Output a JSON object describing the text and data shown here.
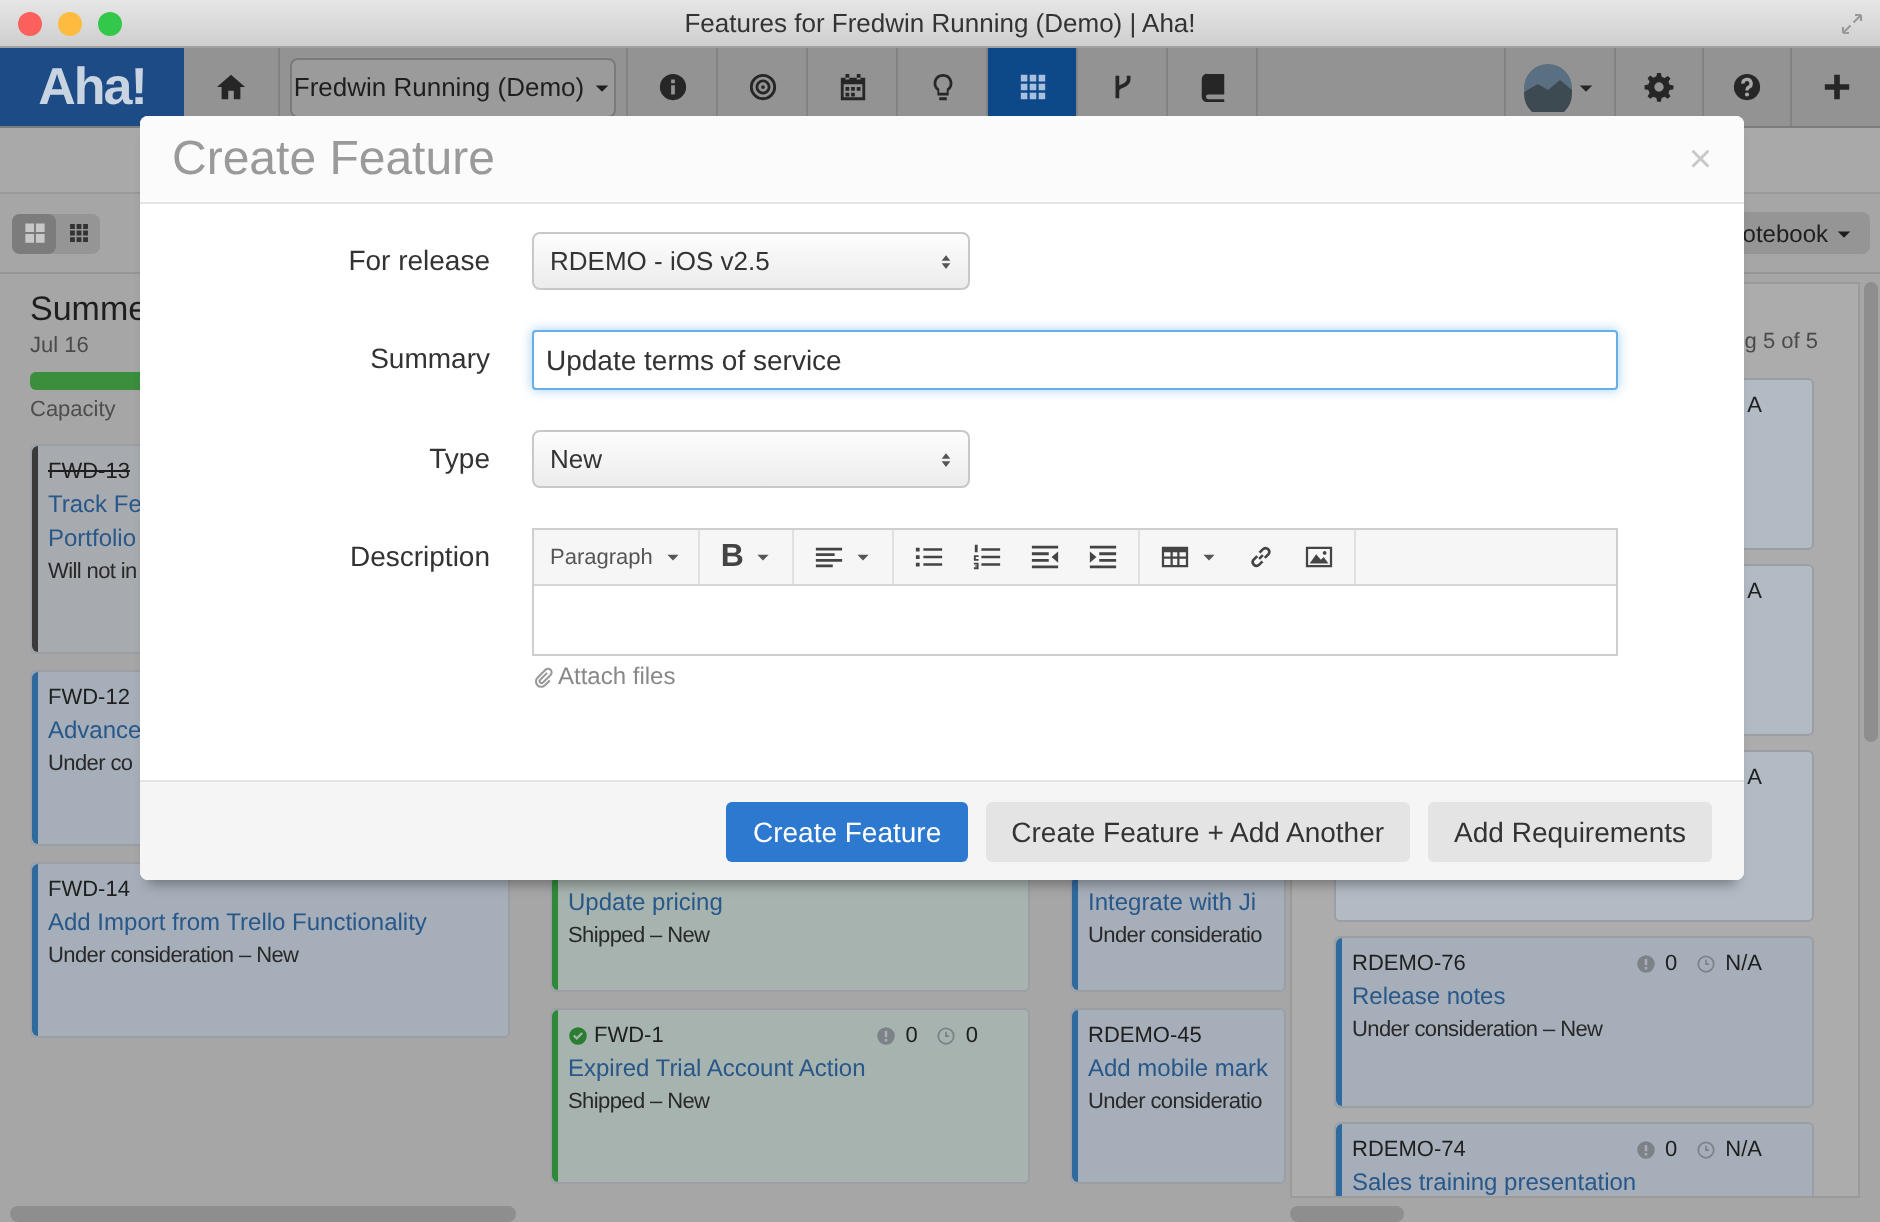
{
  "window": {
    "title": "Features for Fredwin Running (Demo) | Aha!"
  },
  "nav": {
    "logo": "Aha!",
    "home": {
      "kind": "home",
      "selected": false
    },
    "product": "Fredwin Running (Demo)",
    "items": [
      {
        "kind": "info",
        "selected": false
      },
      {
        "kind": "target",
        "selected": false
      },
      {
        "kind": "calendar",
        "selected": false
      },
      {
        "kind": "bulb",
        "selected": false
      },
      {
        "kind": "grid",
        "selected": true
      },
      {
        "kind": "branch",
        "selected": false
      },
      {
        "kind": "book",
        "selected": false
      }
    ],
    "right": [
      {
        "kind": "avatar"
      },
      {
        "kind": "gear"
      },
      {
        "kind": "help"
      },
      {
        "kind": "plus"
      }
    ]
  },
  "toolbar": {
    "views": [
      {
        "kind": "cards",
        "selected": true
      },
      {
        "kind": "grid",
        "selected": false
      }
    ],
    "menu": "otebook"
  },
  "release": {
    "title": "Summe",
    "date": "Jul 16",
    "capacity_label": "Capacity"
  },
  "columns": [
    {
      "cards": [
        {
          "id": "FWD-13",
          "strike": true,
          "done": false,
          "title_lines": [
            "Track Fe",
            "Portfolio"
          ],
          "status": "Will not in",
          "color": "#3a3a3a"
        },
        {
          "id": "FWD-12",
          "strike": false,
          "done": false,
          "title_lines": [
            "Advance"
          ],
          "status": "Under co",
          "color": "#2f6a9e"
        },
        {
          "id": "FWD-14",
          "strike": false,
          "done": false,
          "title_lines": [
            "Add Import from Trello Functionality"
          ],
          "status": "Under consideration – New",
          "color": "#2f6a9e"
        }
      ]
    },
    {
      "cards": [
        {
          "title_lines": [
            "Update pricing"
          ],
          "status": "Shipped – New",
          "color": "#2f8a38"
        },
        {
          "id": "FWD-1",
          "strike": false,
          "done": true,
          "issues": "0",
          "estimate": "0",
          "title_lines": [
            "Expired Trial Account Action"
          ],
          "status": "Shipped – New",
          "color": "#2f8a38"
        }
      ]
    },
    {
      "cards": [
        {
          "title_lines": [
            "Integrate with Ji"
          ],
          "status": "Under consideratio",
          "color": "#2f6a9e"
        },
        {
          "id": "RDEMO-45",
          "strike": false,
          "done": false,
          "title_lines": [
            "Add mobile mark"
          ],
          "status": "Under consideratio",
          "color": "#2f6a9e"
        }
      ]
    }
  ],
  "panel": {
    "header": "g 5 of 5",
    "cards": [
      {
        "estimate": "A"
      },
      {
        "estimate": "A"
      },
      {
        "estimate": "A"
      },
      {
        "id": "RDEMO-76",
        "strike": false,
        "done": false,
        "issues": "0",
        "estimate": "N/A",
        "title_lines": [
          "Release notes"
        ],
        "status": "Under consideration – New",
        "color": "#2f6a9e"
      },
      {
        "id": "RDEMO-74",
        "strike": false,
        "done": false,
        "issues": "0",
        "estimate": "N/A",
        "title_lines": [
          "Sales training presentation"
        ],
        "color": "#2f6a9e"
      }
    ]
  },
  "dialog": {
    "title": "Create Feature",
    "close": "×",
    "fields": [
      {
        "kind": "select",
        "label": "For release",
        "value": "RDEMO - iOS v2.5"
      },
      {
        "kind": "text",
        "label": "Summary",
        "value": "Update terms of service",
        "focused": true
      },
      {
        "kind": "select",
        "label": "Type",
        "value": "New"
      },
      {
        "kind": "editor",
        "label": "Description",
        "format": "Paragraph",
        "attach": "Attach files",
        "tool_groups": [
          [
            {
              "kind": "bold",
              "label": "B",
              "caret": true
            }
          ],
          [
            {
              "kind": "align",
              "caret": true
            }
          ],
          [
            {
              "kind": "bullets",
              "caret": false
            },
            {
              "kind": "numbers",
              "caret": false
            },
            {
              "kind": "outdent",
              "caret": false
            },
            {
              "kind": "indent",
              "caret": false
            }
          ],
          [
            {
              "kind": "table",
              "caret": true
            },
            {
              "kind": "link",
              "caret": false
            },
            {
              "kind": "image",
              "caret": false
            }
          ]
        ]
      }
    ],
    "buttons": [
      {
        "label": "Create Feature",
        "kind": "primary"
      },
      {
        "label": "Create Feature + Add Another",
        "kind": "default"
      },
      {
        "label": "Add Requirements",
        "kind": "default"
      }
    ]
  }
}
